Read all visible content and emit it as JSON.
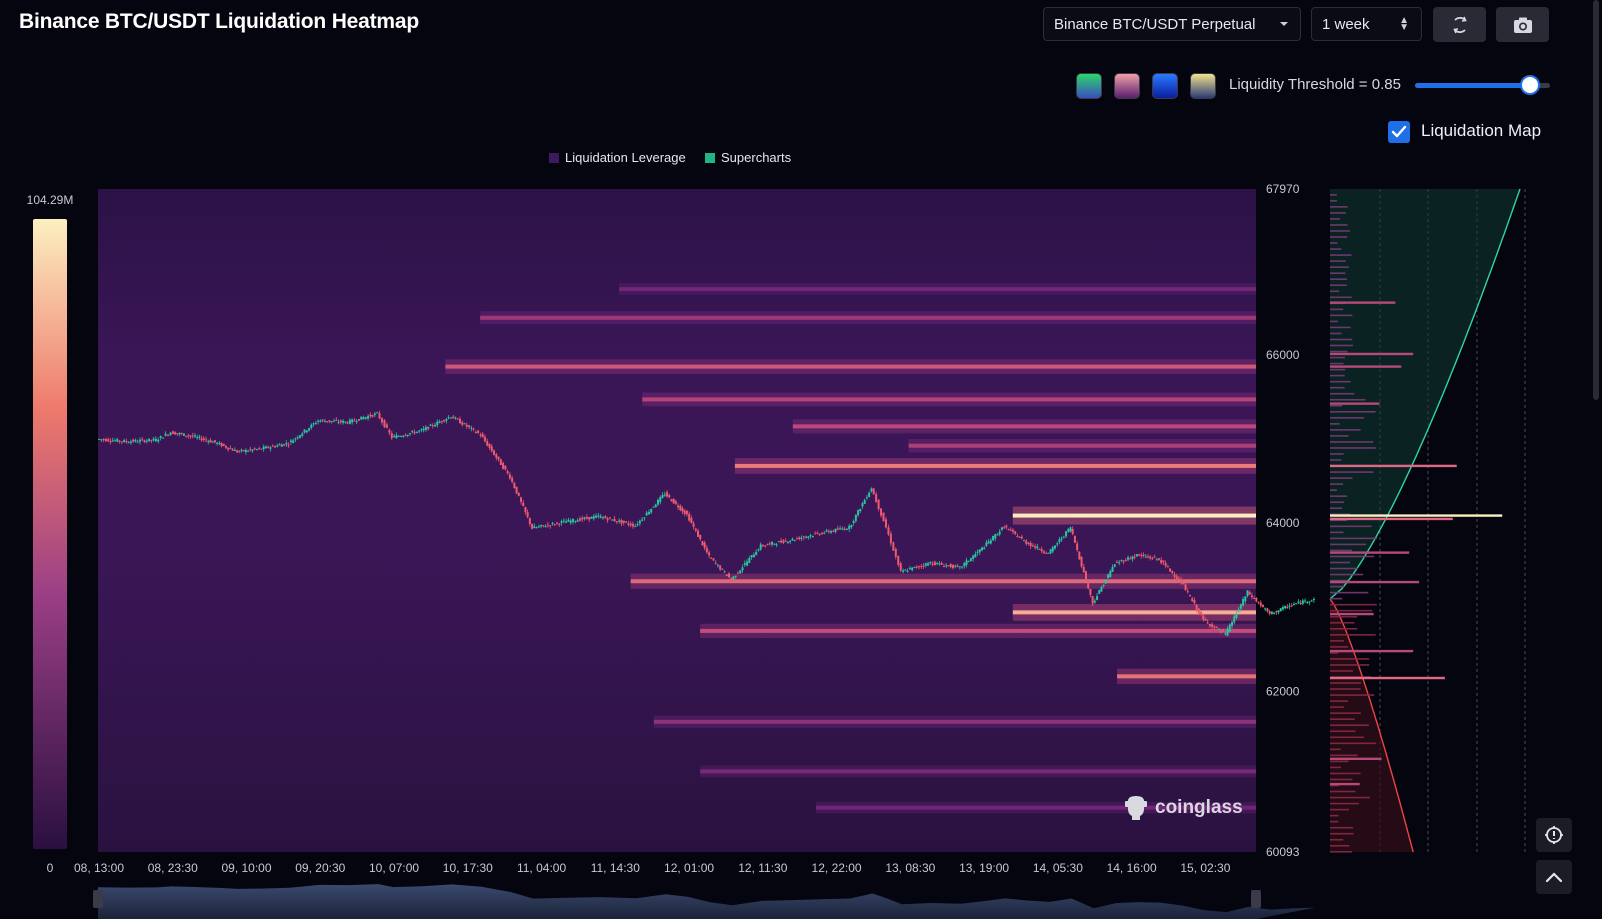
{
  "header": {
    "title": "Binance BTC/USDT Liquidation Heatmap",
    "pair_select": "Binance BTC/USDT Perpetual",
    "range_select": "1 week",
    "refresh_icon": "refresh-icon",
    "screenshot_icon": "camera-icon"
  },
  "controls": {
    "palettes": [
      {
        "name": "viridis",
        "from": "#2bd66b",
        "to": "#3a4dbf"
      },
      {
        "name": "magma",
        "from": "#f0a0a8",
        "to": "#5a1e6e"
      },
      {
        "name": "blue",
        "from": "#2a7bff",
        "to": "#0a1ea0"
      },
      {
        "name": "cividis",
        "from": "#f2e38a",
        "to": "#2a3a78"
      }
    ],
    "threshold_label": "Liquidity Threshold = 0.85",
    "threshold_value": 0.85,
    "liquidation_map_label": "Liquidation Map",
    "liquidation_map_checked": true
  },
  "legend": {
    "items": [
      {
        "label": "Liquidation Leverage",
        "color": "#3d1a5c"
      },
      {
        "label": "Supercharts",
        "color": "#1fb584"
      }
    ]
  },
  "colors": {
    "background": "#050510",
    "heat_low": "#2a1040",
    "heat_high": "#fcefc0",
    "candle_up": "#26c6a0",
    "candle_down": "#ef5a6f",
    "accent": "#1f6fe8"
  },
  "chart_data": {
    "type": "heatmap",
    "title": "Binance BTC/USDT Liquidation Heatmap",
    "colorbar": {
      "min_label": "0",
      "max_label": "104.29M",
      "min": 0,
      "max": 104290000
    },
    "x_ticks": [
      "08, 13:00",
      "08, 23:30",
      "09, 10:00",
      "09, 20:30",
      "10, 07:00",
      "10, 17:30",
      "11, 04:00",
      "11, 14:30",
      "12, 01:00",
      "12, 11:30",
      "12, 22:00",
      "13, 08:30",
      "13, 19:00",
      "14, 05:30",
      "14, 16:00",
      "15, 02:30"
    ],
    "y_ticks": [
      "67970",
      "66000",
      "64000",
      "62000",
      "60093"
    ],
    "ylim": [
      60093,
      67970
    ],
    "price_path": [
      {
        "t": 0,
        "p": 65000
      },
      {
        "t": 0.4,
        "p": 64970
      },
      {
        "t": 0.8,
        "p": 64990
      },
      {
        "t": 1.0,
        "p": 65080
      },
      {
        "t": 1.3,
        "p": 65030
      },
      {
        "t": 1.6,
        "p": 64960
      },
      {
        "t": 1.9,
        "p": 64850
      },
      {
        "t": 2.2,
        "p": 64880
      },
      {
        "t": 2.6,
        "p": 64950
      },
      {
        "t": 3.0,
        "p": 65220
      },
      {
        "t": 3.4,
        "p": 65200
      },
      {
        "t": 3.8,
        "p": 65300
      },
      {
        "t": 4.0,
        "p": 65020
      },
      {
        "t": 4.4,
        "p": 65100
      },
      {
        "t": 4.8,
        "p": 65270
      },
      {
        "t": 5.2,
        "p": 65050
      },
      {
        "t": 5.6,
        "p": 64550
      },
      {
        "t": 5.9,
        "p": 63940
      },
      {
        "t": 6.3,
        "p": 64010
      },
      {
        "t": 6.8,
        "p": 64080
      },
      {
        "t": 7.3,
        "p": 63970
      },
      {
        "t": 7.7,
        "p": 64350
      },
      {
        "t": 8.0,
        "p": 64100
      },
      {
        "t": 8.3,
        "p": 63600
      },
      {
        "t": 8.6,
        "p": 63330
      },
      {
        "t": 9.0,
        "p": 63730
      },
      {
        "t": 9.4,
        "p": 63800
      },
      {
        "t": 9.8,
        "p": 63880
      },
      {
        "t": 10.2,
        "p": 63950
      },
      {
        "t": 10.5,
        "p": 64420
      },
      {
        "t": 10.7,
        "p": 63950
      },
      {
        "t": 10.9,
        "p": 63420
      },
      {
        "t": 11.3,
        "p": 63530
      },
      {
        "t": 11.7,
        "p": 63470
      },
      {
        "t": 12.0,
        "p": 63700
      },
      {
        "t": 12.3,
        "p": 63960
      },
      {
        "t": 12.6,
        "p": 63770
      },
      {
        "t": 12.9,
        "p": 63640
      },
      {
        "t": 13.2,
        "p": 63950
      },
      {
        "t": 13.5,
        "p": 63050
      },
      {
        "t": 13.8,
        "p": 63520
      },
      {
        "t": 14.1,
        "p": 63620
      },
      {
        "t": 14.4,
        "p": 63570
      },
      {
        "t": 14.7,
        "p": 63300
      },
      {
        "t": 15.0,
        "p": 62850
      },
      {
        "t": 15.3,
        "p": 62680
      },
      {
        "t": 15.6,
        "p": 63180
      },
      {
        "t": 15.9,
        "p": 62920
      },
      {
        "t": 16.2,
        "p": 63030
      },
      {
        "t": 16.5,
        "p": 63100
      }
    ],
    "bands": [
      {
        "price": 64680,
        "start": 0.55,
        "intensity": 0.78
      },
      {
        "price": 64090,
        "start": 0.79,
        "intensity": 1.0
      },
      {
        "price": 63310,
        "start": 0.46,
        "intensity": 0.72
      },
      {
        "price": 62940,
        "start": 0.79,
        "intensity": 0.88
      },
      {
        "price": 62720,
        "start": 0.52,
        "intensity": 0.62
      },
      {
        "price": 62180,
        "start": 0.88,
        "intensity": 0.75
      },
      {
        "price": 65860,
        "start": 0.3,
        "intensity": 0.66
      },
      {
        "price": 65470,
        "start": 0.47,
        "intensity": 0.58
      },
      {
        "price": 65150,
        "start": 0.6,
        "intensity": 0.6
      },
      {
        "price": 64920,
        "start": 0.7,
        "intensity": 0.55
      },
      {
        "price": 66440,
        "start": 0.33,
        "intensity": 0.5
      },
      {
        "price": 66780,
        "start": 0.45,
        "intensity": 0.36
      },
      {
        "price": 61640,
        "start": 0.48,
        "intensity": 0.45
      },
      {
        "price": 61050,
        "start": 0.52,
        "intensity": 0.38
      },
      {
        "price": 60620,
        "start": 0.62,
        "intensity": 0.35
      }
    ],
    "side_panel": {
      "labels": [],
      "bars": [
        {
          "price": 64680,
          "v": 0.64
        },
        {
          "price": 64090,
          "v": 0.87
        },
        {
          "price": 64050,
          "v": 0.62
        },
        {
          "price": 63650,
          "v": 0.4
        },
        {
          "price": 63300,
          "v": 0.45
        },
        {
          "price": 62920,
          "v": 0.22
        },
        {
          "price": 62480,
          "v": 0.42
        },
        {
          "price": 62160,
          "v": 0.58
        },
        {
          "price": 66010,
          "v": 0.42
        },
        {
          "price": 65860,
          "v": 0.36
        },
        {
          "price": 66620,
          "v": 0.33
        },
        {
          "price": 65420,
          "v": 0.25
        },
        {
          "price": 61200,
          "v": 0.26
        },
        {
          "price": 60900,
          "v": 0.15
        }
      ]
    }
  },
  "branding": {
    "logo_text": "coinglass"
  },
  "sidebar_buttons": {
    "settings_icon": "settings-icon",
    "up_icon": "chevron-up-icon"
  }
}
